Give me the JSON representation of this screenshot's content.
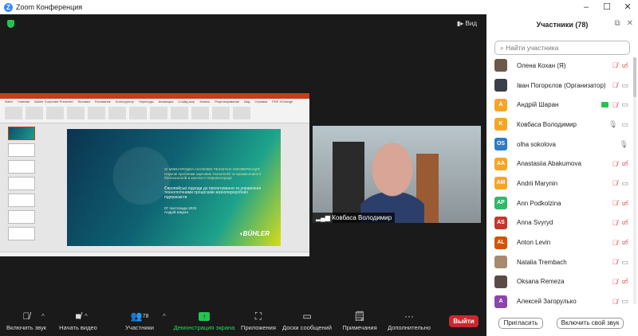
{
  "window": {
    "title": "Zoom Конференция",
    "minimize": "–",
    "maximize": "☐",
    "close": "✕"
  },
  "stage": {
    "view_label": "Вид"
  },
  "slide": {
    "line1": "XI МІЖНАРОДНА НАУКОВО-ТЕХНІЧНА КОНФЕРЕНЦІЯ",
    "line2": "Наукові проблеми харчових технологій та промисловості біотехнологій в контексті Євроінтеграції",
    "title": "Європейські підходи до проектування та управління технологічними процесами зернопереробних підприємств",
    "date": "07 листопада 2023",
    "author": "Андрій Шаран",
    "logo": "BÜHLER"
  },
  "ppt": {
    "tabs": [
      "Файл",
      "Главная",
      "Bühler Corporate Presenter",
      "Вставка",
      "Рисование",
      "Конструктор",
      "Переходы",
      "Анимация",
      "Слайд-шоу",
      "Запись",
      "Рецензирование",
      "Вид",
      "Справка",
      "PDF-XChange"
    ]
  },
  "video": {
    "name": "Ковбаса Володимир"
  },
  "toolbar": {
    "mute": "Включить звук",
    "video": "Начать видео",
    "participants": "Участники",
    "participants_count": "78",
    "share": "Демонстрация экрана",
    "apps": "Приложения",
    "whiteboards": "Доски сообщений",
    "notes": "Примечания",
    "more": "Дополнительно",
    "leave": "Выйти"
  },
  "panel": {
    "title": "Участники (78)",
    "search_placeholder": "Найти участника",
    "invite": "Пригласить",
    "unmute_self": "Включить свой звук",
    "participants": [
      {
        "name": "Олена Кохан (Я)",
        "initials": "",
        "color": "#6b5a4a",
        "mic": "off",
        "cam": "off"
      },
      {
        "name": "Іван Погорєлов (Организатор)",
        "initials": "",
        "color": "#3a4048",
        "mic": "off",
        "cam": "on"
      },
      {
        "name": "Андрій Шаран",
        "initials": "A",
        "color": "#f5a623",
        "mic": "off",
        "cam": "on",
        "sharing": true
      },
      {
        "name": "Ковбаса Володимир",
        "initials": "K",
        "color": "#f5a623",
        "mic": "on",
        "cam": "on"
      },
      {
        "name": "olha sokolova",
        "initials": "OS",
        "color": "#2e7bc4",
        "mic": "on",
        "cam": "none"
      },
      {
        "name": "Anastasiia Abakumova",
        "initials": "AA",
        "color": "#f5a623",
        "mic": "off",
        "cam": "off"
      },
      {
        "name": "Andrii Marynin",
        "initials": "AM",
        "color": "#f5a623",
        "mic": "off",
        "cam": "on"
      },
      {
        "name": "Ann Podkolzina",
        "initials": "AP",
        "color": "#2fb86a",
        "mic": "off",
        "cam": "off"
      },
      {
        "name": "Anna Svyryd",
        "initials": "AS",
        "color": "#c0392b",
        "mic": "off",
        "cam": "off"
      },
      {
        "name": "Anton Levin",
        "initials": "AL",
        "color": "#d35400",
        "mic": "off",
        "cam": "off"
      },
      {
        "name": "Natalia Trembach",
        "initials": "",
        "color": "#a88a70",
        "mic": "off",
        "cam": "on"
      },
      {
        "name": "Oksana Remeza",
        "initials": "",
        "color": "#5a4a48",
        "mic": "off",
        "cam": "off"
      },
      {
        "name": "Алексей Загорулько",
        "initials": "A",
        "color": "#8e44ad",
        "mic": "off",
        "cam": "on"
      }
    ]
  }
}
